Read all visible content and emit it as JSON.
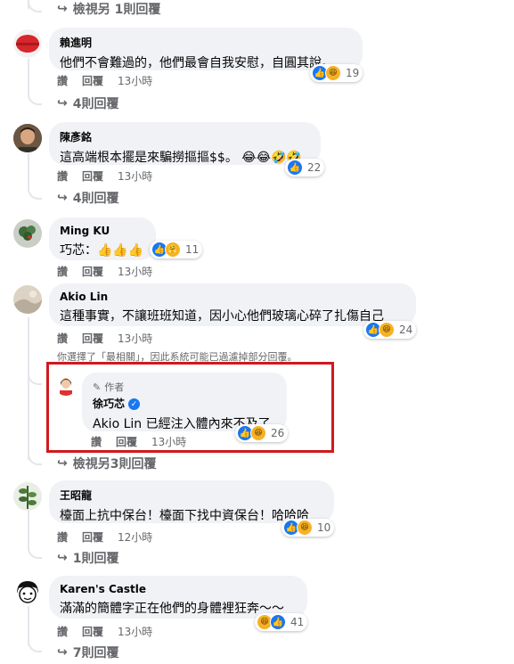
{
  "top_view_more": "檢視另 1則回覆",
  "comments": [
    {
      "name": "賴進明",
      "text": "他們不會難過的，他們最會自我安慰，自圓其說。",
      "like": "讚",
      "reply": "回覆",
      "time": "13小時",
      "reactions": [
        "like-icon",
        "haha-icon"
      ],
      "count": "19",
      "replies_label": "4則回覆"
    },
    {
      "name": "陳彥銘",
      "text": "這高端根本擺是來騙撈摳摳$$。 😂😂🤣🤣",
      "like": "讚",
      "reply": "回覆",
      "time": "13小時",
      "reactions": [
        "like-icon"
      ],
      "count": "22",
      "replies_label": "4則回覆"
    },
    {
      "name": "Ming KU",
      "text": "巧芯：👍👍👍",
      "like": "讚",
      "reply": "回覆",
      "time": "13小時",
      "reactions": [
        "like-icon",
        "care-icon"
      ],
      "count": "11"
    },
    {
      "name": "Akio Lin",
      "text": "這種事實，不讓班班知道，因小心他們玻璃心碎了扎傷自己",
      "like": "讚",
      "reply": "回覆",
      "time": "13小時",
      "reactions": [
        "like-icon",
        "haha-icon"
      ],
      "count": "24"
    }
  ],
  "filter_note": "你選擇了「最相關」，因此系統可能已過濾掉部分回覆。",
  "author_reply": {
    "badge": "作者",
    "name": "徐巧芯",
    "text": "Akio Lin 已經注入體內來不及了",
    "like": "讚",
    "reply": "回覆",
    "time": "13小時",
    "reactions": [
      "like-icon",
      "haha-icon"
    ],
    "count": "26"
  },
  "mid_view_more": "檢視另3則回覆",
  "comments_bottom": [
    {
      "name": "王昭龍",
      "text": "檯面上抗中保台！檯面下找中資保台！哈哈哈",
      "like": "讚",
      "reply": "回覆",
      "time": "12小時",
      "reactions": [
        "like-icon",
        "haha-icon"
      ],
      "count": "10",
      "replies_label": "1則回覆"
    },
    {
      "name": "Karen's Castle",
      "text": "滿滿的簡體字正在他們的身體裡狂奔～～",
      "like": "讚",
      "reply": "回覆",
      "time": "13小時",
      "reactions": [
        "haha-icon",
        "like-icon"
      ],
      "count": "41",
      "replies_label": "7則回覆"
    }
  ],
  "colors": {
    "highlight": "#d0191d",
    "like": "#1877f2",
    "muted": "#65676b",
    "bubble": "#f0f2f5"
  }
}
